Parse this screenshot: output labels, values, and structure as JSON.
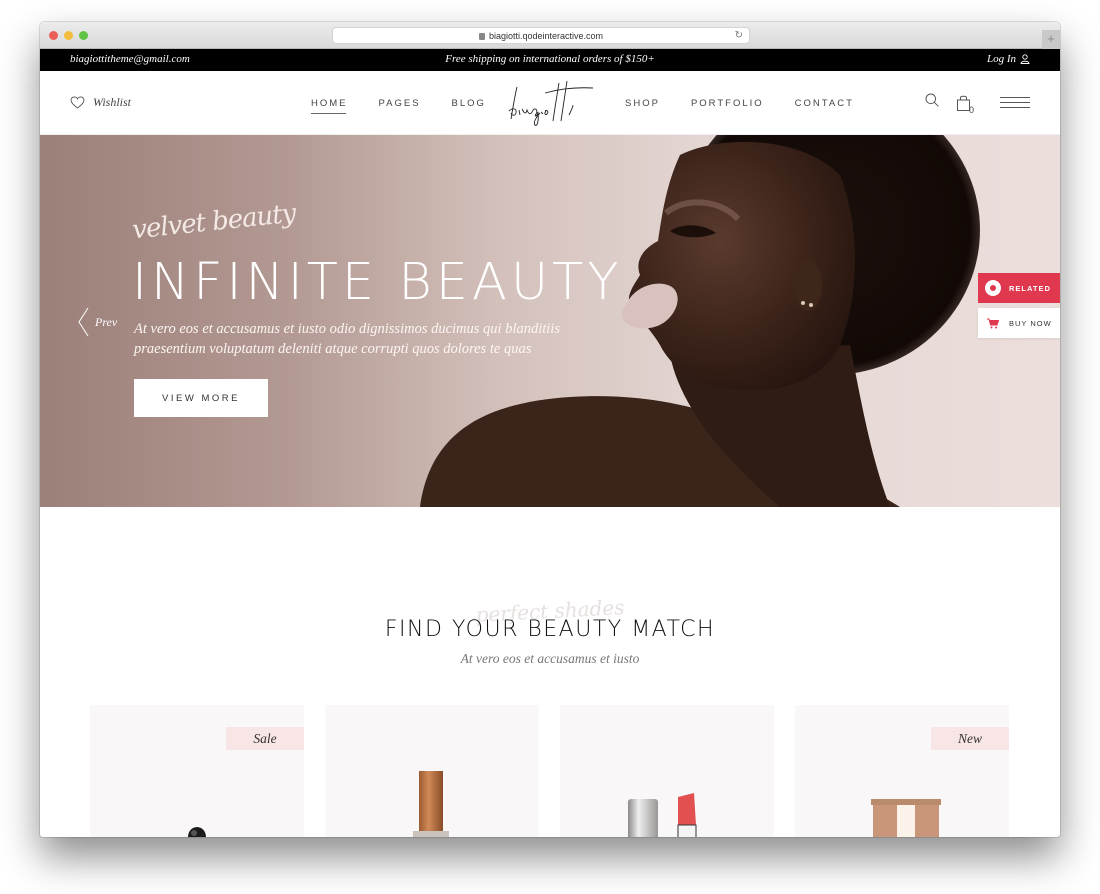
{
  "browser": {
    "url": "biagiotti.qodeinteractive.com",
    "new_tab_label": "+"
  },
  "topbar": {
    "email": "biagiottitheme@gmail.com",
    "shipping": "Free shipping on international orders of $150+",
    "login": "Log In"
  },
  "header": {
    "wishlist": "Wishlist",
    "logo_text": "biagiotti",
    "nav_left": [
      {
        "label": "HOME",
        "active": true
      },
      {
        "label": "PAGES",
        "active": false
      },
      {
        "label": "BLOG",
        "active": false
      }
    ],
    "nav_right": [
      {
        "label": "SHOP",
        "active": false
      },
      {
        "label": "PORTFOLIO",
        "active": false
      },
      {
        "label": "CONTACT",
        "active": false
      }
    ],
    "cart_count": "0"
  },
  "hero": {
    "script_subtitle": "velvet beauty",
    "title": "INFINITE BEAUTY",
    "text_line1": "At vero eos et accusamus et iusto odio dignissimos ducimus qui blanditiis",
    "text_line2": "praesentium voluptatum deleniti atque corrupti quos dolores te quas",
    "prev_label": "Prev",
    "button_label": "VIEW MORE"
  },
  "side_widget": {
    "related": "RELATED",
    "buy_now": "BUY NOW",
    "accent": "#e0394f"
  },
  "section": {
    "script": "perfect shades",
    "title": "FIND YOUR BEAUTY MATCH",
    "subtitle": "At vero eos et accusamus et iusto"
  },
  "products": [
    {
      "badge": "Sale",
      "item": "eyeliner"
    },
    {
      "badge": "",
      "item": "bronze-bottle"
    },
    {
      "badge": "",
      "item": "lipstick"
    },
    {
      "badge": "New",
      "item": "foundation-tube"
    }
  ]
}
